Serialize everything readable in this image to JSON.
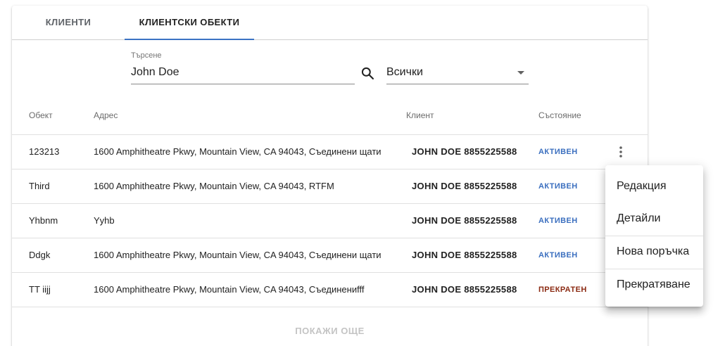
{
  "tabs": [
    {
      "label": "КЛИЕНТИ",
      "active": false
    },
    {
      "label": "КЛИЕНТСКИ ОБЕКТИ",
      "active": true
    }
  ],
  "search": {
    "label": "Търсене",
    "value": "John Doe"
  },
  "filter": {
    "selected": "Всички"
  },
  "table": {
    "headers": [
      "Обект",
      "Адрес",
      "Клиент",
      "Състояние"
    ],
    "rows": [
      {
        "object": "123213",
        "address": "1600 Amphitheatre Pkwy, Mountain View, CA 94043, Съединени щати",
        "client": "JOHN DOE 8855225588",
        "state": "АКТИВЕН"
      },
      {
        "object": "Third",
        "address": "1600 Amphitheatre Pkwy, Mountain View, CA 94043, RTFM",
        "client": "JOHN DOE 8855225588",
        "state": "АКТИВЕН"
      },
      {
        "object": "Yhbnm",
        "address": "Yyhb",
        "client": "JOHN DOE 8855225588",
        "state": "АКТИВЕН"
      },
      {
        "object": "Ddgk",
        "address": "1600 Amphitheatre Pkwy, Mountain View, CA 94043, Съединени щати",
        "client": "JOHN DOE 8855225588",
        "state": "АКТИВЕН"
      },
      {
        "object": "TT iijj",
        "address": "1600 Amphitheatre Pkwy, Mountain View, CA 94043, Съединениfff",
        "client": "JOHN DOE 8855225588",
        "state": "ПРЕКРАТЕН"
      }
    ]
  },
  "more_label": "ПОКАЖИ ОЩЕ",
  "context_menu": {
    "items": [
      "Редакция",
      "Детайли",
      "Нова поръчка",
      "Прекратяване"
    ]
  },
  "colors": {
    "accent": "#3b73c4",
    "active_state": "#3b6fbf",
    "stopped_state": "#8b2a12"
  },
  "icons": {
    "search": "search-icon",
    "filter": "chevron-down-icon",
    "row_menu": "more-vert-icon"
  }
}
